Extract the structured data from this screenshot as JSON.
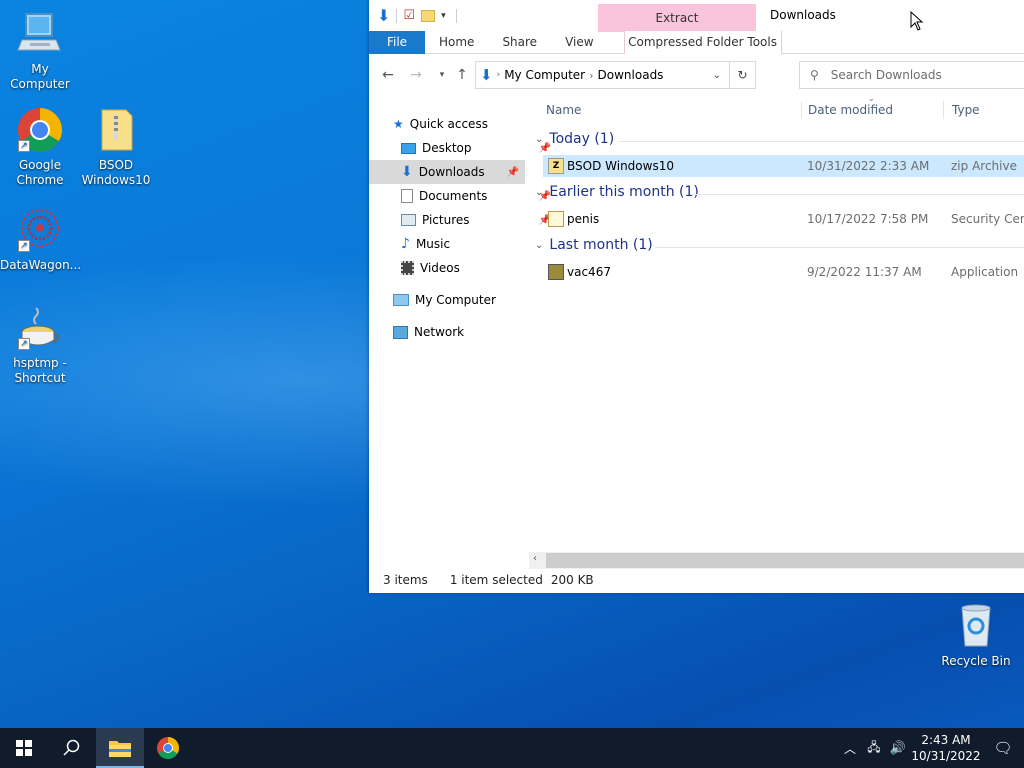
{
  "desktop": {
    "icons": [
      {
        "label": "My Computer"
      },
      {
        "label": "Google Chrome"
      },
      {
        "label": "BSOD Windows10"
      },
      {
        "label": "DataWagon..."
      },
      {
        "label": "hsptmp - Shortcut"
      },
      {
        "label": "Recycle Bin"
      }
    ]
  },
  "explorer": {
    "title": "Downloads",
    "context_tab": "Extract",
    "ribbon_tabs": [
      "File",
      "Home",
      "Share",
      "View",
      "Compressed Folder Tools"
    ],
    "address": {
      "crumbs": [
        "My Computer",
        "Downloads"
      ]
    },
    "search_placeholder": "Search Downloads",
    "nav": {
      "quick_access": "Quick access",
      "items": [
        "Desktop",
        "Downloads",
        "Documents",
        "Pictures",
        "Music",
        "Videos"
      ],
      "my_computer": "My Computer",
      "network": "Network"
    },
    "columns": [
      "Name",
      "Date modified",
      "Type"
    ],
    "groups": [
      {
        "label": "Today (1)",
        "files": [
          {
            "name": "BSOD Windows10",
            "date": "10/31/2022 2:33 AM",
            "type": "zip Archive"
          }
        ]
      },
      {
        "label": "Earlier this month (1)",
        "files": [
          {
            "name": "penis",
            "date": "10/17/2022 7:58 PM",
            "type": "Security Certif"
          }
        ]
      },
      {
        "label": "Last month (1)",
        "files": [
          {
            "name": "vac467",
            "date": "9/2/2022 11:37 AM",
            "type": "Application"
          }
        ]
      }
    ],
    "status": {
      "count": "3 items",
      "selected": "1 item selected",
      "size": "200 KB"
    }
  },
  "taskbar": {
    "clock_time": "2:43 AM",
    "clock_date": "10/31/2022"
  }
}
